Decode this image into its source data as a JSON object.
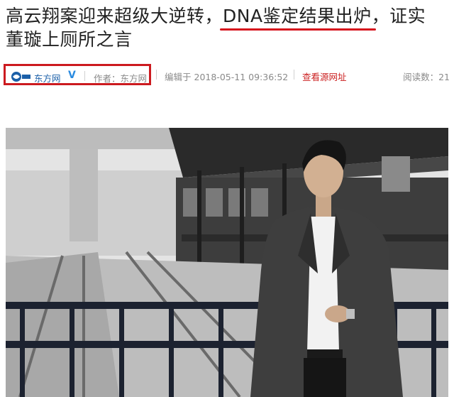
{
  "title": {
    "line1_prefix": "高云翔案迎来超级大逆转，",
    "line1_highlight": "DNA鉴定结果出炉",
    "line1_suffix": "，证实",
    "line2": "董璇上厕所之言"
  },
  "meta": {
    "source_name": "东方网",
    "verified_icon": "verified-v-icon",
    "author_label": "作者：",
    "author": "东方网",
    "edited_label": "编辑于",
    "edited_time": "2018-05-11 09:36:52",
    "view_source": "查看源网址",
    "reads_label": "阅读数：",
    "reads_count": "21"
  },
  "colors": {
    "highlight_red": "#d6121c",
    "link_red": "#cc2222",
    "source_blue": "#1b5fa8"
  },
  "image": {
    "name": "article-photo",
    "subject": "man in grey coat at railway platform"
  }
}
